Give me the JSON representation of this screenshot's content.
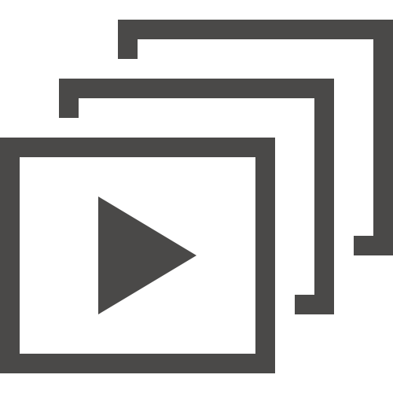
{
  "icon": {
    "name": "video-playlist-icon",
    "color": "#4a4948",
    "background": "#ffffff",
    "stacked_frames": 3,
    "play_glyph": "play-triangle"
  }
}
